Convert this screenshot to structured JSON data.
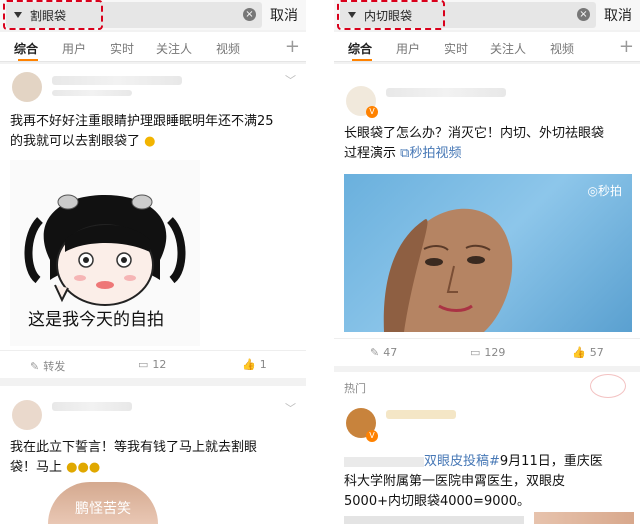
{
  "left": {
    "search_query": "割眼袋",
    "cancel_label": "取消",
    "tabs": [
      "综合",
      "用户",
      "实时",
      "关注人",
      "视频"
    ],
    "post1": {
      "text_line1": "我再不好好注重眼睛护理跟睡眠明年还不满25",
      "text_line2": "的我就可以去割眼袋了",
      "meme_caption": "这是我今天的自拍",
      "actions": {
        "repost": "转发",
        "comments": "12",
        "likes": "1"
      }
    },
    "post2": {
      "text_line1": "我在此立下誓言！等我有钱了马上就去割眼",
      "text_line2": "袋！马上",
      "photo_caption": "鹏怪苦笑"
    }
  },
  "right": {
    "search_query": "内切眼袋",
    "cancel_label": "取消",
    "tabs": [
      "综合",
      "用户",
      "实时",
      "关注人",
      "视频"
    ],
    "post1": {
      "text_line1": "长眼袋了怎么办？消灭它！内切、外切祛眼袋",
      "text_line2": "过程演示",
      "video_link": "秒拍视频",
      "video_badge": "秒拍",
      "actions": {
        "reposts": "47",
        "comments": "129",
        "likes": "57"
      }
    },
    "hot_label": "热门",
    "post2": {
      "hashtag": "双眼皮投稿#",
      "text_line1": "9月11日，重庆医",
      "text_line2": "科大学附属第一医院申霄医生，双眼皮",
      "text_line3": "5000+内切眼袋4000=9000。"
    }
  },
  "colors": {
    "accent_orange": "#ff8200",
    "highlight_red": "#d9001b",
    "link_blue": "#4778b6"
  }
}
